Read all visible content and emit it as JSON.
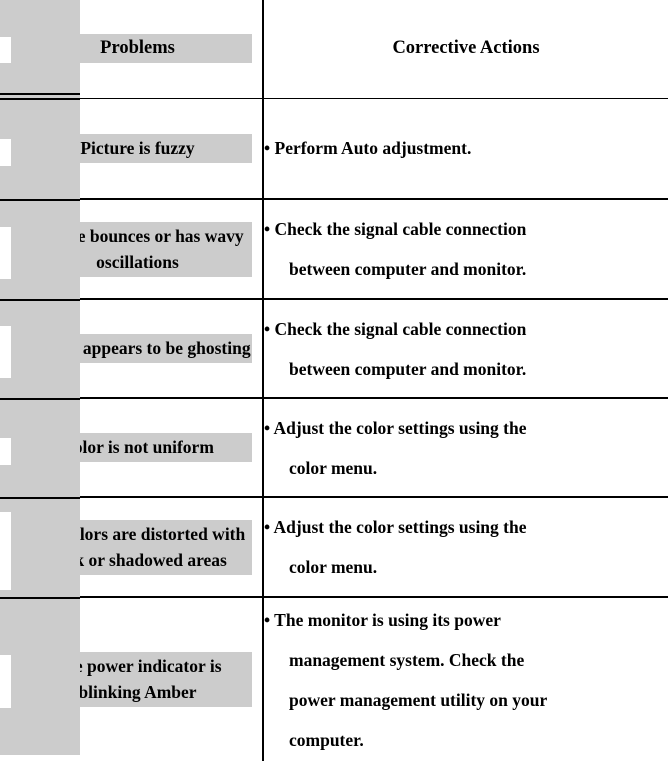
{
  "document": {
    "type": "troubleshooting-table",
    "colors": {
      "band": "#cccccc",
      "highlight": "#cccccc",
      "rule": "#000000",
      "text": "#000000",
      "page": "#ffffff"
    }
  },
  "table": {
    "columns": [
      {
        "key": "problems",
        "header": "Problems"
      },
      {
        "key": "actions",
        "header": "Corrective Actions"
      }
    ],
    "rows": [
      {
        "problem": "Picture is fuzzy",
        "action_lines": [
          "• Perform Auto adjustment."
        ]
      },
      {
        "problem": "Picture bounces or has wavy oscillations",
        "action_lines": [
          "• Check the signal cable connection",
          "between computer and monitor."
        ]
      },
      {
        "problem": "Picture appears to be ghosting",
        "action_lines": [
          "• Check the signal cable connection",
          "between computer and monitor."
        ]
      },
      {
        "problem": "Color is not uniform",
        "action_lines": [
          "• Adjust the color settings using the",
          "color menu."
        ]
      },
      {
        "problem": "The colors are distorted with dark or shadowed areas",
        "action_lines": [
          "• Adjust the color settings using the",
          "color menu."
        ]
      },
      {
        "problem": "The power indicator is blinking Amber",
        "action_lines": [
          "• The monitor is using its power",
          "management system. Check the",
          "power management utility on your",
          "computer."
        ]
      }
    ]
  }
}
